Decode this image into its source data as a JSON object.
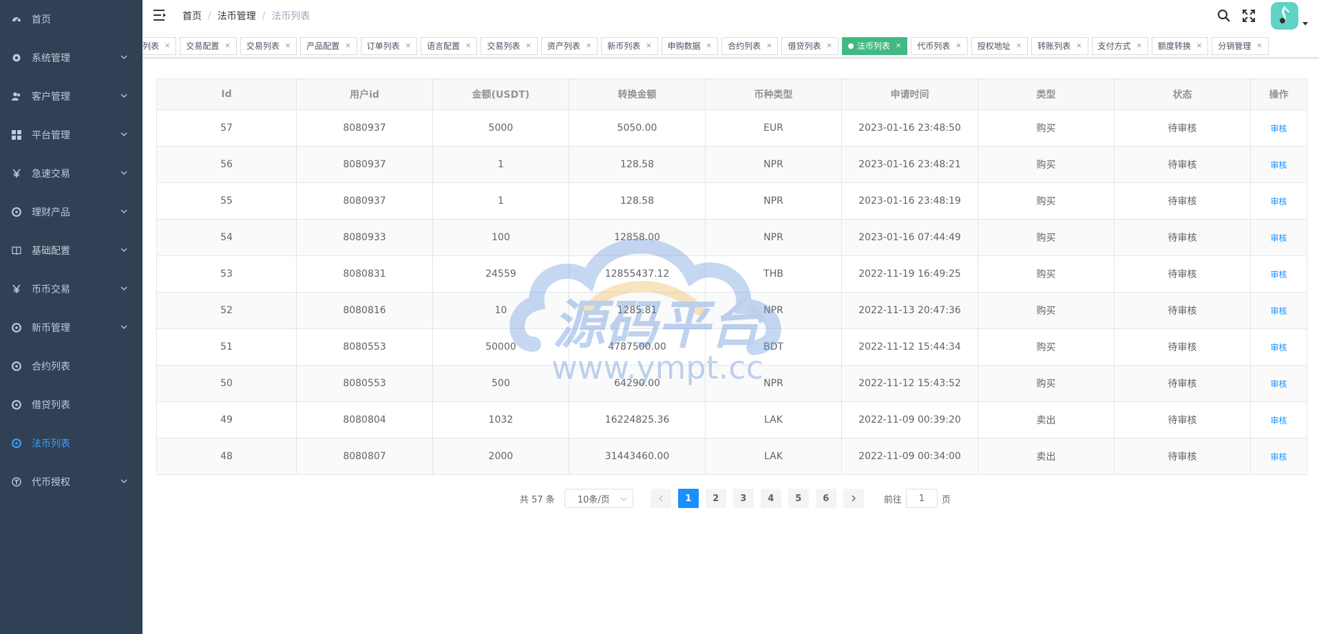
{
  "colors": {
    "sidebar_bg": "#304156",
    "sidebar_text": "#bfcbd9",
    "sidebar_active": "#409eff",
    "tag_active": "#42b983",
    "link": "#1890ff",
    "avatar_bg": "#5fd3c6"
  },
  "sidebar": {
    "items": [
      {
        "label": "首页",
        "icon": "dashboard-icon",
        "has_arrow": false
      },
      {
        "label": "系统管理",
        "icon": "gear-icon",
        "has_arrow": true
      },
      {
        "label": "客户管理",
        "icon": "users-icon",
        "has_arrow": true
      },
      {
        "label": "平台管理",
        "icon": "grid-icon",
        "has_arrow": true
      },
      {
        "label": "急速交易",
        "icon": "yen-icon",
        "has_arrow": true
      },
      {
        "label": "理财产品",
        "icon": "circle-icon",
        "has_arrow": true
      },
      {
        "label": "基础配置",
        "icon": "book-icon",
        "has_arrow": true
      },
      {
        "label": "币币交易",
        "icon": "yen-icon",
        "has_arrow": true
      },
      {
        "label": "新币管理",
        "icon": "circle-icon",
        "has_arrow": true
      },
      {
        "label": "合约列表",
        "icon": "circle-icon",
        "has_arrow": false
      },
      {
        "label": "借贷列表",
        "icon": "circle-icon",
        "has_arrow": false
      },
      {
        "label": "法币列表",
        "icon": "circle-icon",
        "has_arrow": false,
        "active": true
      },
      {
        "label": "代币授权",
        "icon": "token-icon",
        "has_arrow": true
      }
    ]
  },
  "navbar": {
    "breadcrumb": [
      "首页",
      "法币管理",
      "法币列表"
    ]
  },
  "tags": [
    {
      "label": "列表"
    },
    {
      "label": "交易配置"
    },
    {
      "label": "交易列表"
    },
    {
      "label": "产品配置"
    },
    {
      "label": "订单列表"
    },
    {
      "label": "语言配置"
    },
    {
      "label": "交易列表"
    },
    {
      "label": "资产列表"
    },
    {
      "label": "新币列表"
    },
    {
      "label": "申购数据"
    },
    {
      "label": "合约列表"
    },
    {
      "label": "借贷列表"
    },
    {
      "label": "法币列表",
      "active": true
    },
    {
      "label": "代币列表"
    },
    {
      "label": "授权地址"
    },
    {
      "label": "转账列表"
    },
    {
      "label": "支付方式"
    },
    {
      "label": "额度转换"
    },
    {
      "label": "分销管理"
    }
  ],
  "tag_close_glyph": "×",
  "table": {
    "headers": [
      "Id",
      "用户id",
      "金额(USDT)",
      "转换金额",
      "币种类型",
      "申请时间",
      "类型",
      "状态",
      "操作"
    ],
    "rows": [
      {
        "id": "57",
        "uid": "8080937",
        "amount": "5000",
        "converted": "5050.00",
        "currency": "EUR",
        "time": "2023-01-16 23:48:50",
        "type": "购买",
        "status": "待审核",
        "action": "审核"
      },
      {
        "id": "56",
        "uid": "8080937",
        "amount": "1",
        "converted": "128.58",
        "currency": "NPR",
        "time": "2023-01-16 23:48:21",
        "type": "购买",
        "status": "待审核",
        "action": "审核"
      },
      {
        "id": "55",
        "uid": "8080937",
        "amount": "1",
        "converted": "128.58",
        "currency": "NPR",
        "time": "2023-01-16 23:48:19",
        "type": "购买",
        "status": "待审核",
        "action": "审核"
      },
      {
        "id": "54",
        "uid": "8080933",
        "amount": "100",
        "converted": "12858.00",
        "currency": "NPR",
        "time": "2023-01-16 07:44:49",
        "type": "购买",
        "status": "待审核",
        "action": "审核"
      },
      {
        "id": "53",
        "uid": "8080831",
        "amount": "24559",
        "converted": "12855437.12",
        "currency": "THB",
        "time": "2022-11-19 16:49:25",
        "type": "购买",
        "status": "待审核",
        "action": "审核"
      },
      {
        "id": "52",
        "uid": "8080816",
        "amount": "10",
        "converted": "1285.81",
        "currency": "NPR",
        "time": "2022-11-13 20:47:36",
        "type": "购买",
        "status": "待审核",
        "action": "审核"
      },
      {
        "id": "51",
        "uid": "8080553",
        "amount": "50000",
        "converted": "4787500.00",
        "currency": "BDT",
        "time": "2022-11-12 15:44:34",
        "type": "购买",
        "status": "待审核",
        "action": "审核"
      },
      {
        "id": "50",
        "uid": "8080553",
        "amount": "500",
        "converted": "64290.00",
        "currency": "NPR",
        "time": "2022-11-12 15:43:52",
        "type": "购买",
        "status": "待审核",
        "action": "审核"
      },
      {
        "id": "49",
        "uid": "8080804",
        "amount": "1032",
        "converted": "16224825.36",
        "currency": "LAK",
        "time": "2022-11-09 00:39:20",
        "type": "卖出",
        "status": "待审核",
        "action": "审核"
      },
      {
        "id": "48",
        "uid": "8080807",
        "amount": "2000",
        "converted": "31443460.00",
        "currency": "LAK",
        "time": "2022-11-09 00:34:00",
        "type": "卖出",
        "status": "待审核",
        "action": "审核"
      }
    ]
  },
  "pagination": {
    "total_text": "共 57 条",
    "page_size": "10条/页",
    "pages": [
      "1",
      "2",
      "3",
      "4",
      "5",
      "6"
    ],
    "current": "1",
    "goto_prefix": "前往",
    "goto_value": "1",
    "goto_suffix": "页"
  },
  "watermark": {
    "title": "源码平台",
    "url": "www.ympt.cc"
  }
}
